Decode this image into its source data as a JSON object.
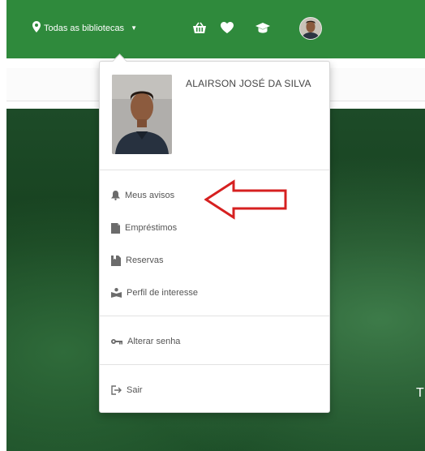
{
  "navbar": {
    "library_selector": "Todas as bibliotecas",
    "icons": [
      "map-pin-icon",
      "basket-icon",
      "heart-icon",
      "graduation-cap-icon"
    ],
    "color": "#2f8a3c"
  },
  "user": {
    "name": "ALAIRSON JOSÉ DA SILVA"
  },
  "menu": {
    "items": [
      {
        "label": "Meus avisos",
        "icon": "bell-icon"
      },
      {
        "label": "Empréstimos",
        "icon": "book-icon"
      },
      {
        "label": "Reservas",
        "icon": "bookmark-icon"
      },
      {
        "label": "Perfil de interesse",
        "icon": "reader-icon"
      },
      {
        "label": "Alterar senha",
        "icon": "key-icon"
      },
      {
        "label": "Sair",
        "icon": "sign-out-icon"
      }
    ]
  },
  "annotation": {
    "arrow_color": "#d62020"
  },
  "hero": {
    "partial_text": "T"
  }
}
